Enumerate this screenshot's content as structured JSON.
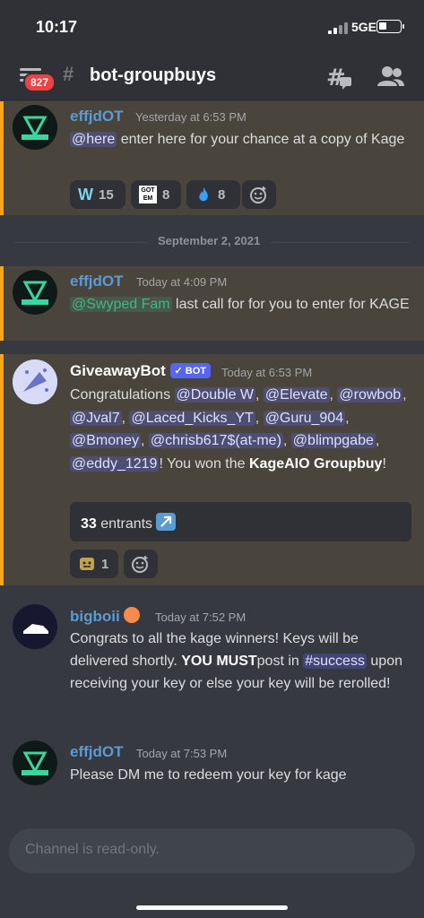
{
  "status": {
    "time": "10:17",
    "network": "5GE"
  },
  "header": {
    "badge_count": "827",
    "channel": "bot-groupbuys"
  },
  "messages": [
    {
      "username": "effjdOT",
      "username_color": "#5b9bd5",
      "timestamp": "Yesterday at 6:53 PM",
      "mention": "@here",
      "text": " enter here for your chance at a copy of Kage",
      "reactions": [
        {
          "emoji": "W",
          "count": "15"
        },
        {
          "emoji": "GOT EM",
          "count": "8"
        },
        {
          "emoji": "fire",
          "count": "8"
        }
      ]
    },
    {
      "username": "effjdOT",
      "username_color": "#5b9bd5",
      "timestamp": "Today at 4:09 PM",
      "mention": "@Swyped Fam",
      "text": " last call for for you to enter for KAGE"
    },
    {
      "username": "GiveawayBot",
      "username_color": "#ffffff",
      "bot_tag": "BOT",
      "timestamp": "Today at 6:53 PM",
      "congrats": "Congratulations ",
      "mentions": [
        "@Double W",
        "@Elevate",
        "@rowbob",
        "@Jval7",
        "@Laced_Kicks_YT",
        "@Guru_904",
        "@Bmoney",
        "@chrisb617$(at-me)",
        "@blimpgabe",
        "@eddy_1219"
      ],
      "won_text": "! You won the",
      "prize": "KageAIO Groupbuy",
      "prize_end": "!",
      "entrants_count": "33",
      "entrants_label": " entrants",
      "reactions": [
        {
          "emoji": "tada-face",
          "count": "1"
        }
      ]
    },
    {
      "username": "bigboii",
      "username_color": "#5b9bd5",
      "timestamp": "Today at 7:52 PM",
      "text_a": "Congrats to all the kage winners! Keys will be delivered shortly. ",
      "bold": "YOU MUST",
      "text_b": "post in ",
      "channel_mention": "#success",
      "text_c": " upon receiving your key or else your key will be rerolled!"
    },
    {
      "username": "effjdOT",
      "username_color": "#5b9bd5",
      "timestamp": "Today at 7:53 PM",
      "text": "Please DM me to redeem your key for kage"
    }
  ],
  "date_divider": "September 2, 2021",
  "input": {
    "placeholder": "Channel is read-only."
  }
}
